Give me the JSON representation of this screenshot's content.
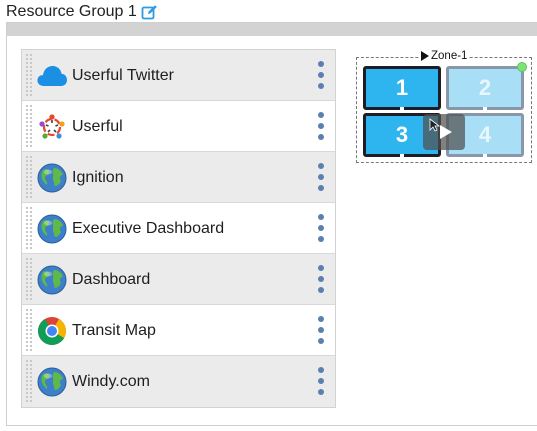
{
  "header": {
    "title": "Resource Group 1",
    "edit_icon": "edit-icon"
  },
  "apps": [
    {
      "label": "Userful Twitter",
      "icon": "cloud-icon"
    },
    {
      "label": "Userful",
      "icon": "userful-logo-icon"
    },
    {
      "label": "Ignition",
      "icon": "globe-icon"
    },
    {
      "label": "Executive Dashboard",
      "icon": "globe-icon"
    },
    {
      "label": "Dashboard",
      "icon": "globe-icon"
    },
    {
      "label": "Transit Map",
      "icon": "chrome-icon"
    },
    {
      "label": "Windy.com",
      "icon": "globe-icon"
    }
  ],
  "zone": {
    "label": "Zone-1",
    "screens": [
      {
        "number": "1",
        "state": "active"
      },
      {
        "number": "2",
        "state": "inactive"
      },
      {
        "number": "3",
        "state": "active"
      },
      {
        "number": "4",
        "state": "inactive"
      }
    ],
    "status": "online"
  },
  "colors": {
    "accent": "#2eb4ee",
    "kebab": "#5b7fb0",
    "status": "#7ee27a",
    "row_alt": "#ebebeb"
  }
}
